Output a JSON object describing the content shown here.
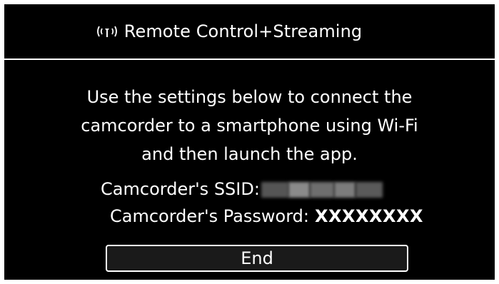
{
  "header": {
    "icon": "wifi-antenna-icon",
    "title": "Remote Control+Streaming"
  },
  "message": {
    "lines": [
      "Use the settings below to connect the",
      "camcorder to a smartphone using Wi-Fi",
      "and then launch the app."
    ]
  },
  "connection": {
    "ssid_label": "Camcorder's SSID:",
    "password_label": "Camcorder's Password:",
    "password_value": "XXXXXXXX"
  },
  "actions": {
    "end_label": "End"
  },
  "colors": {
    "background": "#000000",
    "text": "#ffffff"
  }
}
